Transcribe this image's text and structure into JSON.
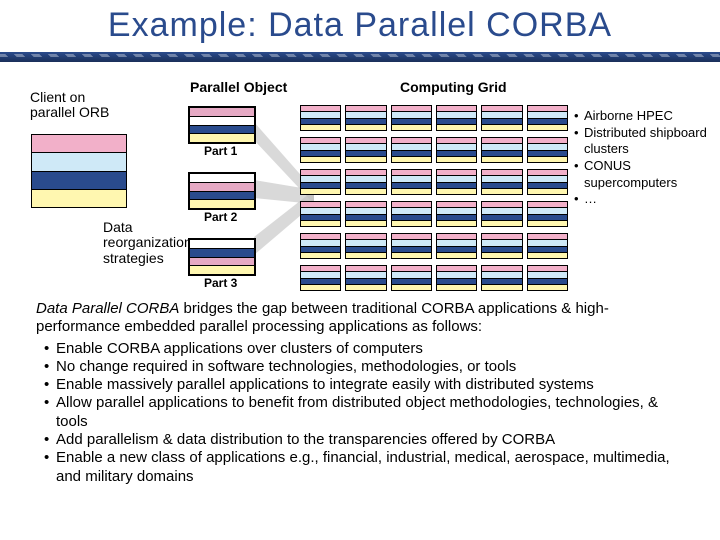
{
  "title": "Example: Data Parallel CORBA",
  "diagram": {
    "client_label": "Client on\nparallel ORB",
    "parallel_object_label": "Parallel Object",
    "computing_grid_label": "Computing Grid",
    "reorg_label": "Data\nreorganization\nstrategies",
    "part_labels": [
      "Part 1",
      "Part 2",
      "Part 3"
    ]
  },
  "right_bullets": [
    "Airborne HPEC",
    "Distributed shipboard clusters",
    "CONUS supercomputers",
    "…"
  ],
  "body": {
    "intro_em": "Data Parallel CORBA",
    "intro_rest": " bridges the gap between traditional CORBA applications & high-performance embedded parallel processing applications as follows:",
    "bullets": [
      "Enable CORBA applications over clusters of computers",
      "No change required in software technologies, methodologies, or tools",
      "Enable massively parallel applications to integrate easily with distributed systems",
      "Allow parallel applications to benefit from distributed object methodologies, technologies, & tools",
      "Add parallelism & data distribution to the transparencies offered by CORBA",
      "Enable a new class of applications e.g., financial, industrial, medical, aerospace, multimedia, and military domains"
    ]
  }
}
